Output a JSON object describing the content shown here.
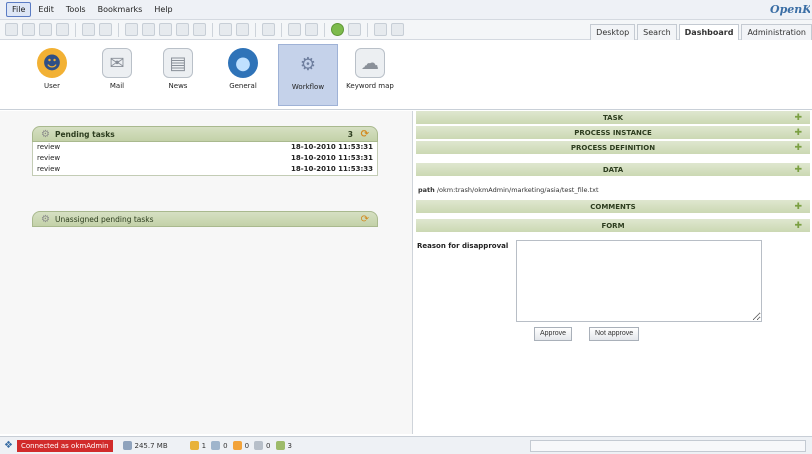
{
  "menu": {
    "items": [
      "File",
      "Edit",
      "Tools",
      "Bookmarks",
      "Help"
    ],
    "active": "File"
  },
  "brand": "OpenKM",
  "tabs": [
    "Desktop",
    "Search",
    "Dashboard",
    "Administration"
  ],
  "active_tab": "Dashboard",
  "launcher": {
    "items": [
      {
        "label": "User",
        "icon": "user-icon"
      },
      {
        "label": "Mail",
        "icon": "mail-icon"
      },
      {
        "label": "News",
        "icon": "news-icon"
      },
      {
        "label": "General",
        "icon": "globe-icon"
      },
      {
        "label": "Workflow",
        "icon": "workflow-gear-icon"
      },
      {
        "label": "Keyword map",
        "icon": "keyword-map-icon"
      }
    ],
    "active": "Workflow"
  },
  "pending": {
    "title": "Pending tasks",
    "count": "3",
    "rows": [
      {
        "name": "review",
        "date": "18-10-2010 11:53:31"
      },
      {
        "name": "review",
        "date": "18-10-2010 11:53:31"
      },
      {
        "name": "review",
        "date": "18-10-2010 11:53:33"
      }
    ]
  },
  "unassigned": {
    "title": "Unassigned pending tasks"
  },
  "sections": {
    "task": "TASK",
    "process_instance": "PROCESS INSTANCE",
    "process_definition": "PROCESS DEFINITION",
    "data": "DATA",
    "comments": "COMMENTS",
    "form": "FORM"
  },
  "path": {
    "label": "path",
    "value": "/okm:trash/okmAdmin/marketing/asia/test_file.txt"
  },
  "form": {
    "reason_label": "Reason for disapproval",
    "approve": "Approve",
    "not_approve": "Not approve"
  },
  "status": {
    "connected": "Connected as okmAdmin",
    "size": "245.7 MB",
    "counters": [
      "1",
      "0",
      "0",
      "0",
      "3"
    ]
  }
}
